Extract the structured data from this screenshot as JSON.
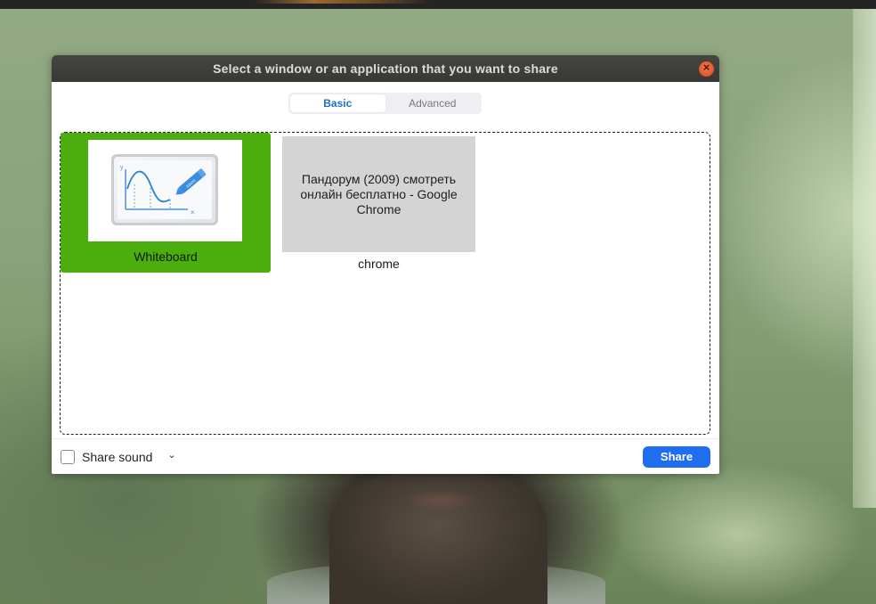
{
  "dialog": {
    "title": "Select a window or an application that you want to share",
    "close_icon": "close-icon"
  },
  "tabs": [
    {
      "label": "Basic",
      "active": true
    },
    {
      "label": "Advanced",
      "active": false
    }
  ],
  "sources": [
    {
      "label": "Whiteboard",
      "selected": true,
      "thumbnail": "whiteboard-graph-icon"
    },
    {
      "label": "chrome",
      "selected": false,
      "thumbnail_text": "Пандорум (2009) смотреть онлайн бесплатно - Google Chrome"
    }
  ],
  "footer": {
    "share_sound_label": "Share sound",
    "share_sound_checked": false,
    "dropdown_icon": "chevron-down-icon",
    "share_button_label": "Share"
  },
  "colors": {
    "selection": "#4cae0e",
    "primary_button": "#1f6ef0",
    "active_tab_text": "#1d6fcf",
    "close_button": "#e2562a"
  }
}
